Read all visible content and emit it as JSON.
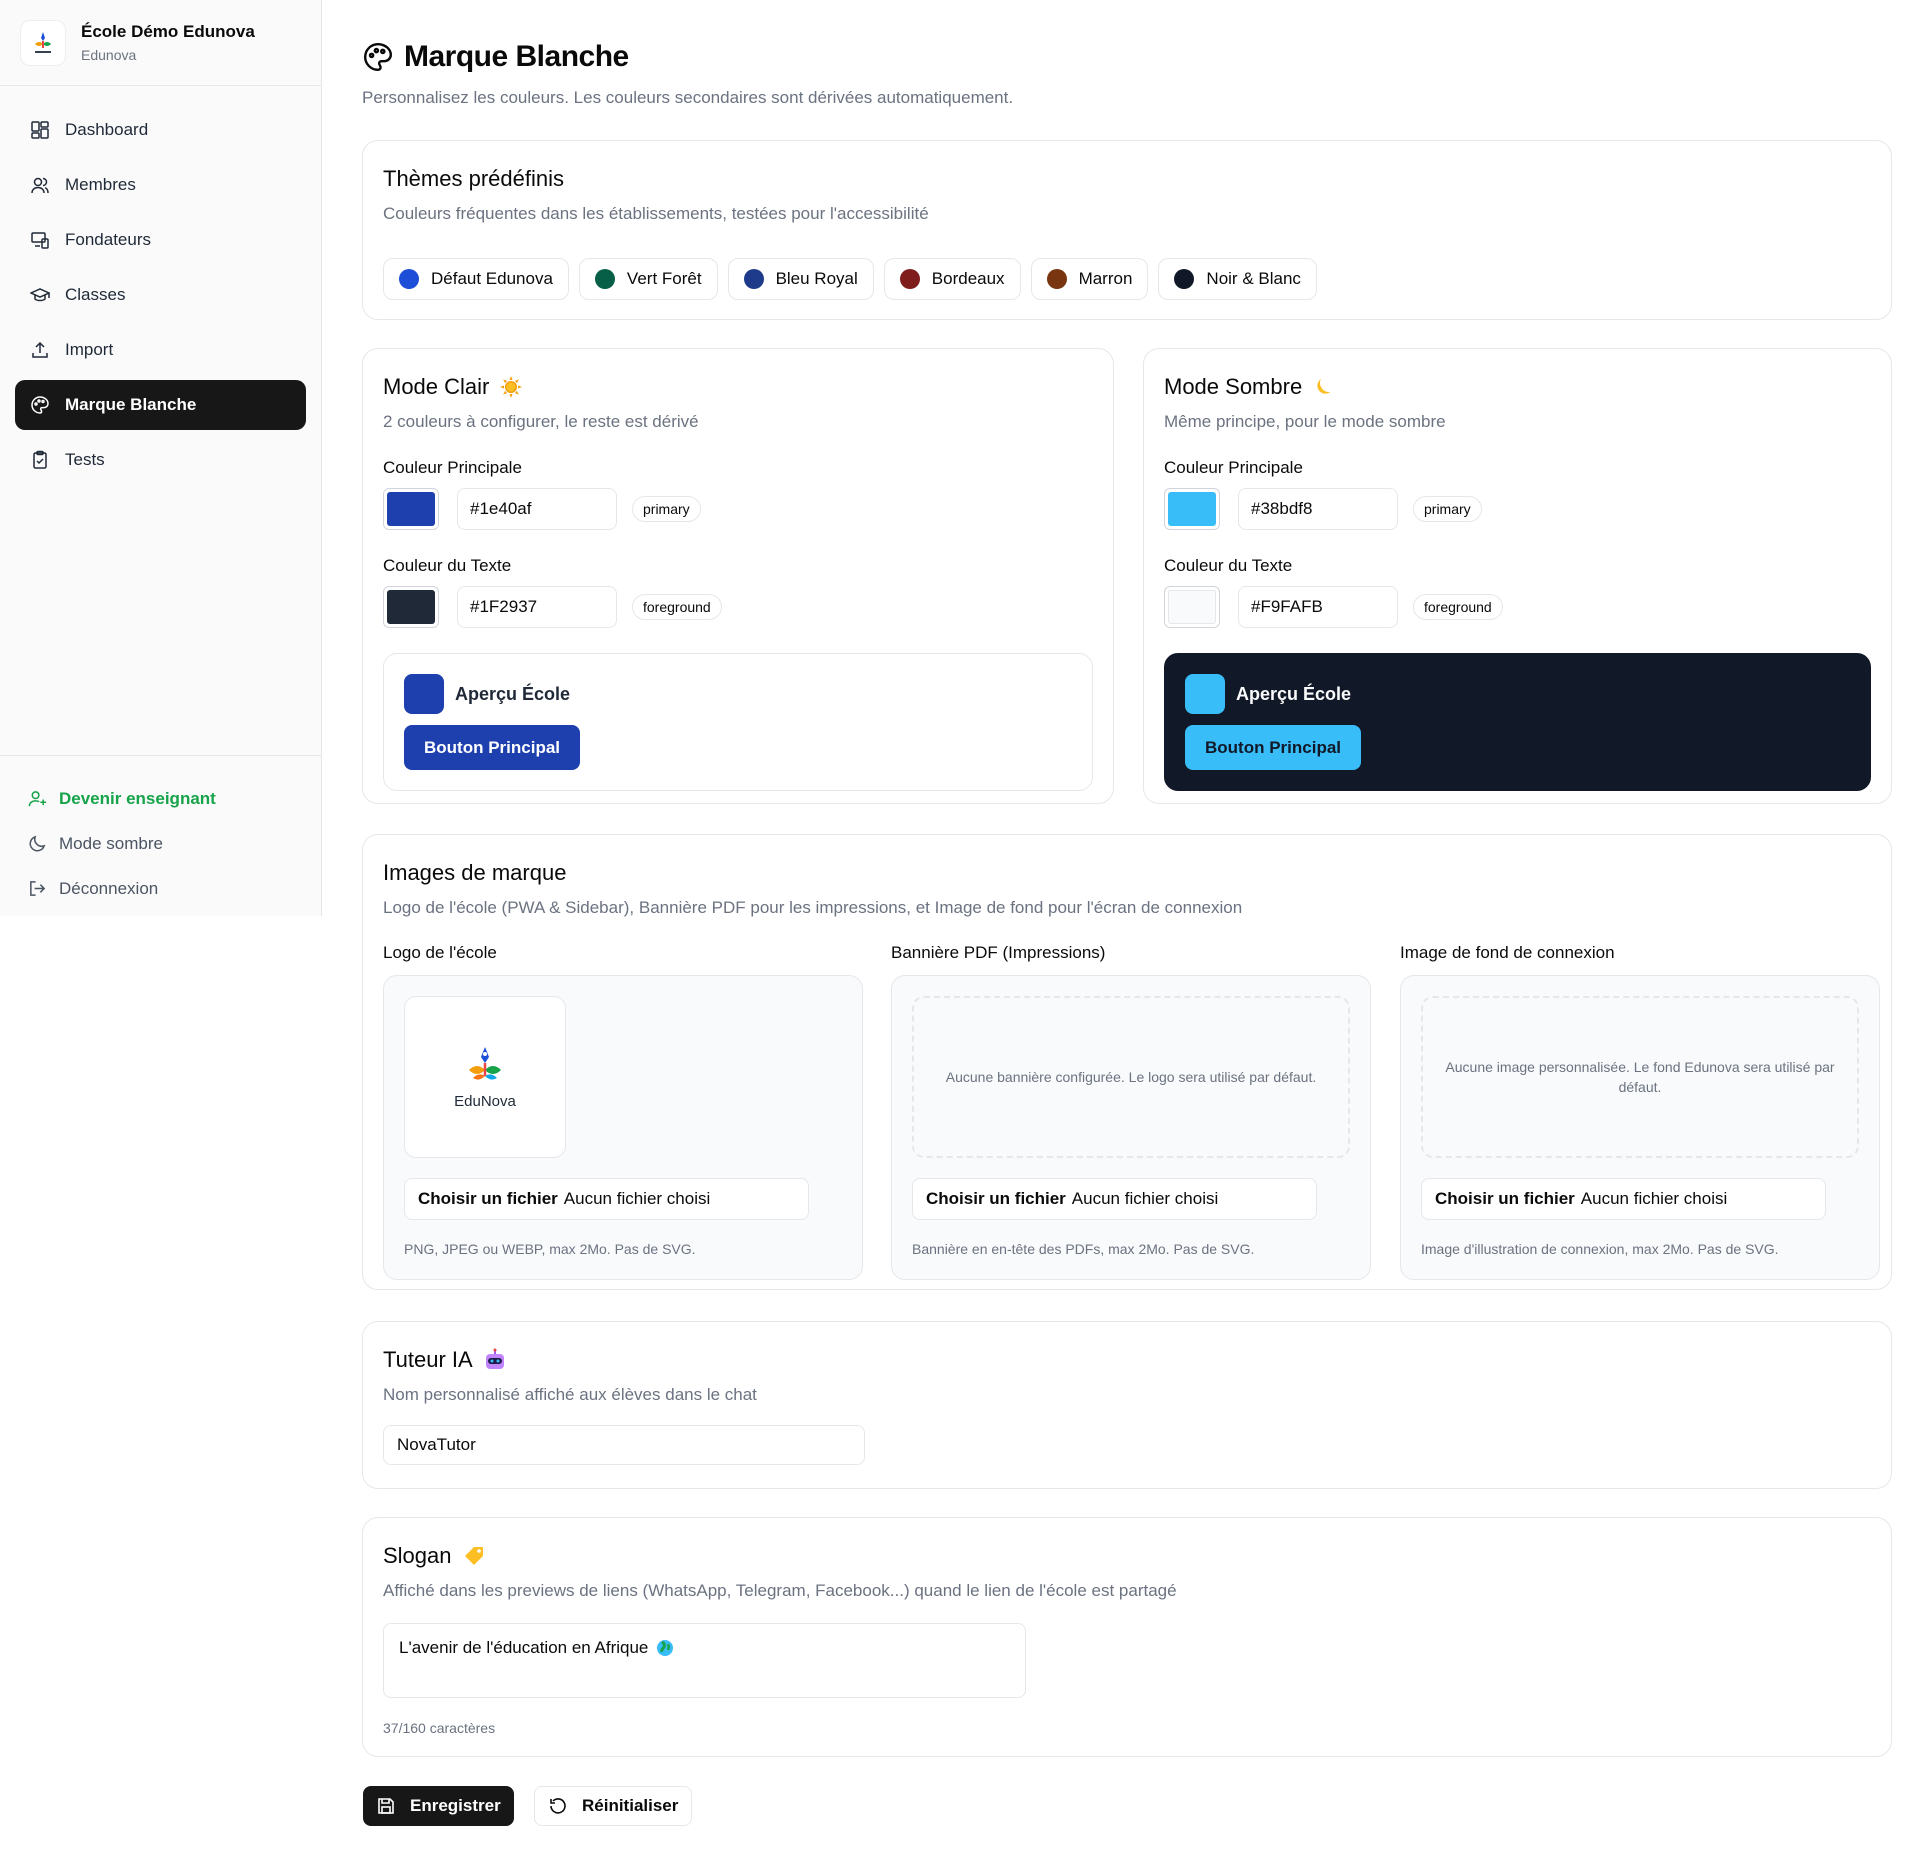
{
  "sidebar": {
    "school_name": "École Démo Edunova",
    "school_sub": "Edunova",
    "items": [
      {
        "label": "Dashboard",
        "icon": "dashboard-icon"
      },
      {
        "label": "Membres",
        "icon": "users-icon"
      },
      {
        "label": "Fondateurs",
        "icon": "devices-icon"
      },
      {
        "label": "Classes",
        "icon": "graduation-cap-icon"
      },
      {
        "label": "Import",
        "icon": "upload-icon"
      },
      {
        "label": "Marque Blanche",
        "icon": "palette-icon",
        "active": true
      },
      {
        "label": "Tests",
        "icon": "clipboard-check-icon"
      }
    ],
    "footer": {
      "become_teacher": "Devenir enseignant",
      "dark_mode": "Mode sombre",
      "logout": "Déconnexion"
    }
  },
  "page": {
    "title": "Marque Blanche",
    "subtitle": "Personnalisez les couleurs. Les couleurs secondaires sont dérivées automatiquement."
  },
  "themes": {
    "title": "Thèmes prédéfinis",
    "desc": "Couleurs fréquentes dans les établissements, testées pour l'accessibilité",
    "items": [
      {
        "label": "Défaut Edunova",
        "color": "#1d4ed8"
      },
      {
        "label": "Vert Forêt",
        "color": "#065f46"
      },
      {
        "label": "Bleu Royal",
        "color": "#1e3a8a"
      },
      {
        "label": "Bordeaux",
        "color": "#7f1d1d"
      },
      {
        "label": "Marron",
        "color": "#78350f"
      },
      {
        "label": "Noir & Blanc",
        "color": "#111827"
      }
    ]
  },
  "light": {
    "title": "Mode Clair",
    "desc": "2 couleurs à configurer, le reste est dérivé",
    "primary_label": "Couleur Principale",
    "primary_value": "#1e40af",
    "primary_tag": "primary",
    "text_label": "Couleur du Texte",
    "text_value": "#1F2937",
    "text_tag": "foreground",
    "preview_name": "Aperçu École",
    "preview_button": "Bouton Principal"
  },
  "dark": {
    "title": "Mode Sombre",
    "desc": "Même principe, pour le mode sombre",
    "primary_label": "Couleur Principale",
    "primary_value": "#38bdf8",
    "primary_tag": "primary",
    "text_label": "Couleur du Texte",
    "text_value": "#F9FAFB",
    "text_tag": "foreground",
    "preview_name": "Aperçu École",
    "preview_button": "Bouton Principal",
    "preview_bg": "#111827"
  },
  "images": {
    "title": "Images de marque",
    "desc": "Logo de l'école (PWA & Sidebar), Bannière PDF pour les impressions, et Image de fond pour l'écran de connexion",
    "logo": {
      "label": "Logo de l'école",
      "logo_word_a": "Edu",
      "logo_word_b": "Nova",
      "file_button": "Choisir un fichier",
      "file_status": "Aucun fichier choisi",
      "hint": "PNG, JPEG ou WEBP, max 2Mo. Pas de SVG."
    },
    "banner": {
      "label": "Bannière PDF (Impressions)",
      "empty": "Aucune bannière configurée. Le logo sera utilisé par défaut.",
      "file_button": "Choisir un fichier",
      "file_status": "Aucun fichier choisi",
      "hint": "Bannière en en-tête des PDFs, max 2Mo. Pas de SVG."
    },
    "background": {
      "label": "Image de fond de connexion",
      "empty": "Aucune image personnalisée. Le fond Edunova sera utilisé par défaut.",
      "file_button": "Choisir un fichier",
      "file_status": "Aucun fichier choisi",
      "hint": "Image d'illustration de connexion, max 2Mo. Pas de SVG."
    }
  },
  "tutor": {
    "title": "Tuteur IA",
    "desc": "Nom personnalisé affiché aux élèves dans le chat",
    "value": "NovaTutor"
  },
  "slogan": {
    "title": "Slogan",
    "desc": "Affiché dans les previews de liens (WhatsApp, Telegram, Facebook...) quand le lien de l'école est partagé",
    "value": "L'avenir de l'éducation en Afrique",
    "counter": "37/160 caractères"
  },
  "actions": {
    "save": "Enregistrer",
    "reset": "Réinitialiser"
  }
}
